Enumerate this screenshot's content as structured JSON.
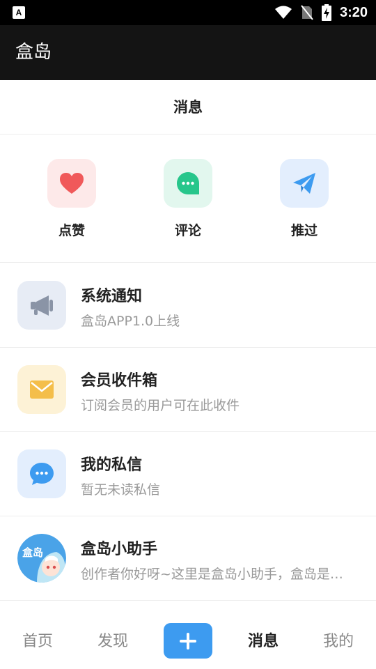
{
  "status_bar": {
    "time": "3:20",
    "left_icon_letter": "A"
  },
  "app_bar": {
    "title": "盒岛"
  },
  "page": {
    "header_title": "消息"
  },
  "quick_actions": [
    {
      "label": "点赞",
      "icon": "heart-icon",
      "bg": "#fde9e9",
      "color": "#f0595a"
    },
    {
      "label": "评论",
      "icon": "chat-bubble-icon",
      "bg": "#e2f7ee",
      "color": "#27c68b"
    },
    {
      "label": "推过",
      "icon": "paper-plane-icon",
      "bg": "#e3eefd",
      "color": "#3d9bf0"
    }
  ],
  "messages": [
    {
      "title": "系统通知",
      "subtitle": "盒岛APP1.0上线",
      "icon": "megaphone-icon",
      "bg": "#e7ecf5",
      "color": "#8a94a6"
    },
    {
      "title": "会员收件箱",
      "subtitle": "订阅会员的用户可在此收件",
      "icon": "envelope-icon",
      "bg": "#fdf2d6",
      "color": "#f4be4a"
    },
    {
      "title": "我的私信",
      "subtitle": "暂无未读私信",
      "icon": "message-bubble-icon",
      "bg": "#e3eefd",
      "color": "#3d9bf0"
    },
    {
      "title": "盒岛小助手",
      "subtitle": "创作者你好呀~这里是盒岛小助手，盒岛是一个为创作者提供服务的平台",
      "icon": "assistant-avatar",
      "avatar_text": "盒岛"
    }
  ],
  "bottom_nav": {
    "items": [
      "首页",
      "发现",
      "消息",
      "我的"
    ],
    "active": "消息",
    "add_icon": "plus-icon",
    "accent": "#3d9bf0"
  }
}
